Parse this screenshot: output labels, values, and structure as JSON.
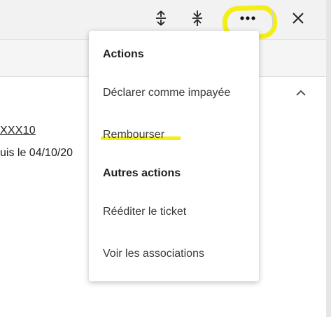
{
  "page": {
    "bg": "#ffffff",
    "topbar_bg": "#f2f2f2",
    "highlight_color": "#f3ef14"
  },
  "toolbar": {
    "expand_icon": "expand-vertical-icon",
    "collapse_icon": "collapse-vertical-icon",
    "more_icon": "more-horizontal-icon",
    "close_icon": "close-icon"
  },
  "content": {
    "reference_link": "XXX10",
    "info_text": "uis le 04/10/20",
    "chevron_icon": "chevron-up-icon"
  },
  "menu": {
    "actions_heading": "Actions",
    "items_actions": [
      {
        "label": "Déclarer comme impayée"
      },
      {
        "label": "Rembourser"
      }
    ],
    "other_heading": "Autres actions",
    "items_other": [
      {
        "label": "Rééditer le ticket"
      },
      {
        "label": "Voir les associations"
      }
    ]
  }
}
